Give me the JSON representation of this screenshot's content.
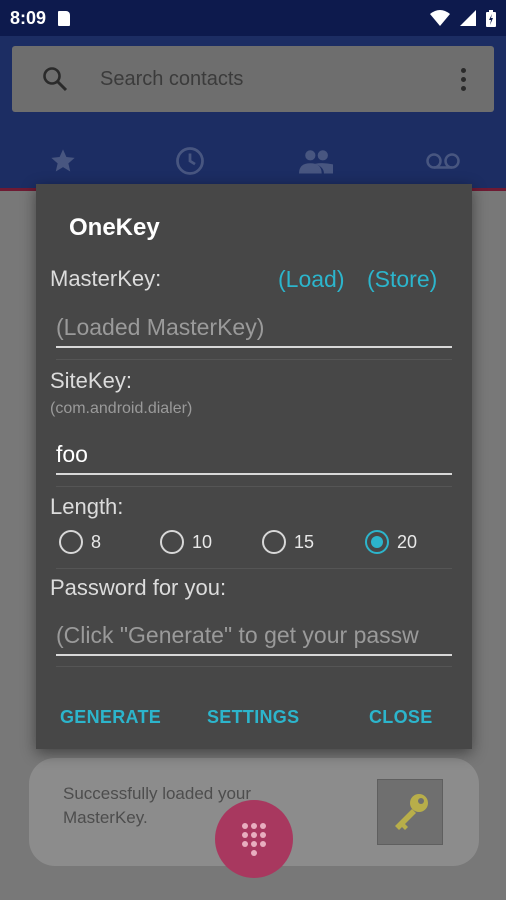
{
  "status": {
    "time": "8:09"
  },
  "search": {
    "placeholder": "Search contacts"
  },
  "dialog": {
    "title": "OneKey",
    "masterkey_label": "MasterKey:",
    "load_link": "(Load)",
    "store_link": "(Store)",
    "masterkey_placeholder": "(Loaded MasterKey)",
    "sitekey_label": "SiteKey:",
    "sitekey_hint": "(com.android.dialer)",
    "sitekey_value": "foo",
    "length_label": "Length:",
    "length_options": [
      "8",
      "10",
      "15",
      "20"
    ],
    "length_selected": "20",
    "password_label": "Password for you:",
    "password_placeholder": "(Click \"Generate\" to get your passw",
    "buttons": {
      "generate": "GENERATE",
      "settings": "SETTINGS",
      "close": "CLOSE"
    }
  },
  "snackbar": {
    "message": "Successfully loaded your MasterKey."
  },
  "colors": {
    "accent": "#2cb5cc",
    "dialog_bg": "#474747",
    "appbar": "#1c2d63",
    "fab": "#a8385f"
  }
}
